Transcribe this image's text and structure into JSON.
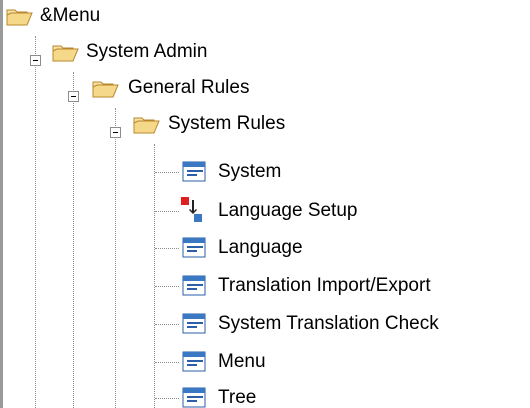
{
  "tree": {
    "nodes": [
      {
        "label": "&Menu",
        "icon": "folder-open-icon"
      },
      {
        "label": "System Admin",
        "icon": "folder-open-icon"
      },
      {
        "label": "General Rules",
        "icon": "folder-open-icon"
      },
      {
        "label": "System Rules",
        "icon": "folder-open-icon"
      },
      {
        "label": "System",
        "icon": "window-icon"
      },
      {
        "label": "Language Setup",
        "icon": "language-setup-icon"
      },
      {
        "label": "Language",
        "icon": "window-icon"
      },
      {
        "label": "Translation Import/Export",
        "icon": "window-icon"
      },
      {
        "label": "System Translation Check",
        "icon": "window-icon"
      },
      {
        "label": "Menu",
        "icon": "window-icon"
      },
      {
        "label": "Tree",
        "icon": "window-icon"
      }
    ]
  },
  "colors": {
    "folder": "#f6d88a",
    "folder_outline": "#b8872b",
    "window_title": "#3a78c4",
    "tree_lines": "#8c8c8c"
  }
}
